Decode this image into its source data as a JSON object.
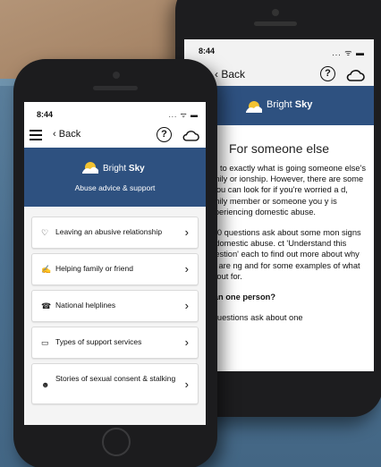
{
  "back_phone": {
    "status_time": "8:44",
    "status_icons": "... ᯤ ▬",
    "back_label": "Back",
    "help_symbol": "?",
    "brand_prefix": "Bright ",
    "brand_bold": "Sky",
    "page_title": "For someone else",
    "paragraphs": [
      "ard to exactly what is going someone else's family or ionship. However, there are some s you can look for if you're worried a d, family member or someone you y is experiencing domestic abuse.",
      "e 10 questions ask about some mon signs of domestic abuse. ct 'Understand this question' each to find out more about why we are ng and for some examples of what ok out for."
    ],
    "question": "than one person?",
    "trailing": "e questions ask about one"
  },
  "front_phone": {
    "status_time": "8:44",
    "status_icons": "... ᯤ ▬",
    "back_label": "Back",
    "help_symbol": "?",
    "brand_prefix": "Bright ",
    "brand_bold": "Sky",
    "subtitle": "Abuse advice & support",
    "menu_items": [
      {
        "label": "Leaving an abusive relationship",
        "icon": "heart-broken-icon",
        "glyph": "♡"
      },
      {
        "label": "Helping family or friend",
        "icon": "handshake-icon",
        "glyph": "✍"
      },
      {
        "label": "National helplines",
        "icon": "support-person-icon",
        "glyph": "☎"
      },
      {
        "label": "Types of support services",
        "icon": "laptop-icon",
        "glyph": "▭"
      },
      {
        "label": "Stories of sexual consent & stalking",
        "icon": "people-icon",
        "glyph": "☻"
      }
    ],
    "chevron": "›"
  },
  "colors": {
    "header_blue": "#2e5180",
    "wall_blue": "#4c7191"
  }
}
